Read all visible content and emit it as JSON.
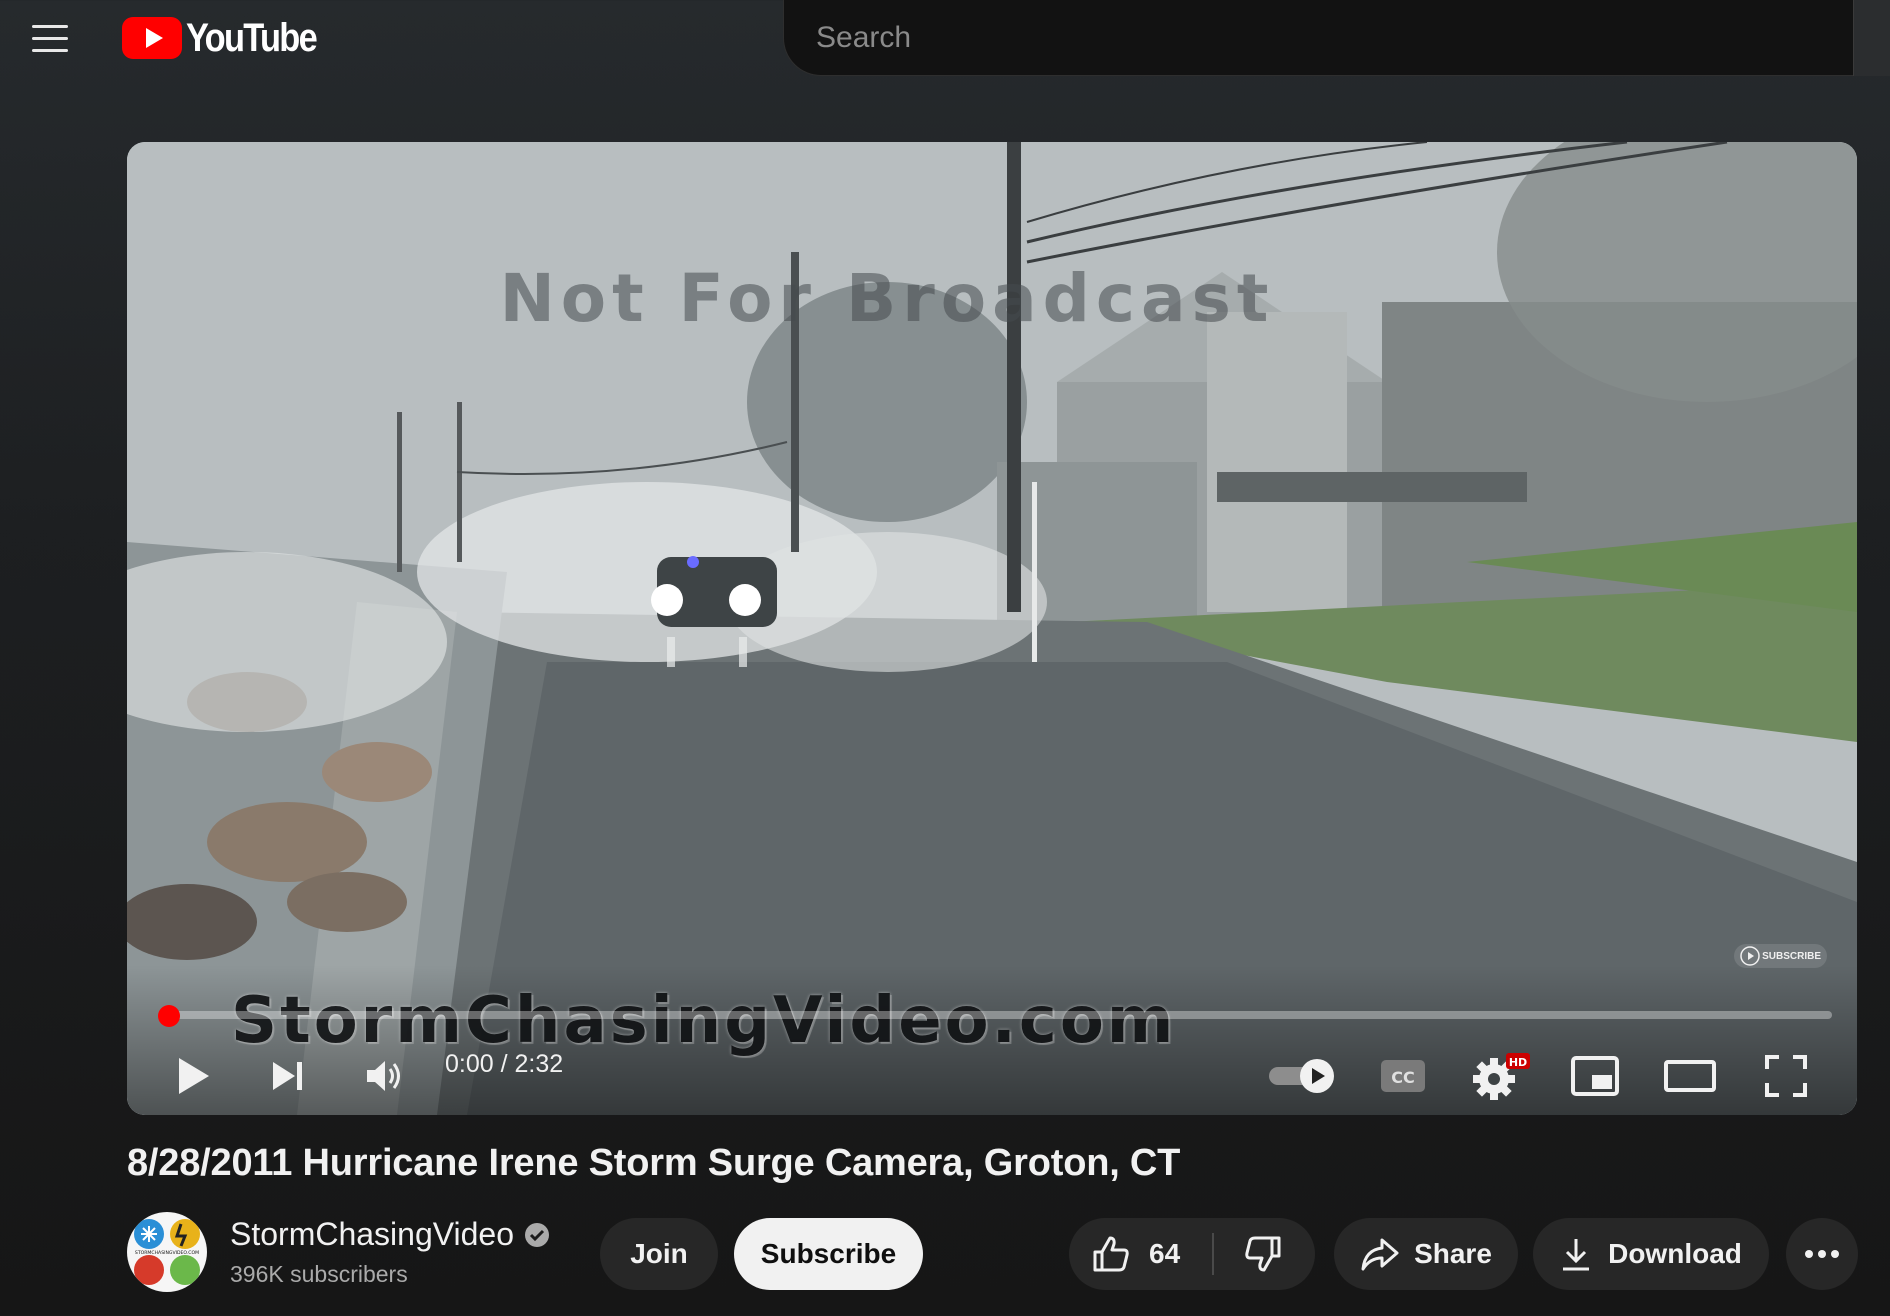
{
  "header": {
    "logo_text": "YouTube",
    "search_placeholder": "Search"
  },
  "video": {
    "watermark_top": "Not For Broadcast",
    "watermark_bottom": "StormChasingVideo.com",
    "subscribe_badge": "SUBSCRIBE",
    "time_display": "0:00 / 2:32",
    "settings_badge": "HD",
    "progress_fraction": 0,
    "title": "8/28/2011 Hurricane Irene Storm Surge Camera, Groton, CT"
  },
  "channel": {
    "name": "StormChasingVideo",
    "subscribers": "396K subscribers",
    "avatar_text": "STORMCHASINGVIDEO.COM",
    "verified": true
  },
  "actions": {
    "join_label": "Join",
    "subscribe_label": "Subscribe",
    "like_count": "64",
    "share_label": "Share",
    "download_label": "Download"
  },
  "colors": {
    "brand_red": "#ff0000",
    "background": "#1d1f21",
    "pill_dark": "#272727",
    "pill_light": "#f1f1f1"
  }
}
